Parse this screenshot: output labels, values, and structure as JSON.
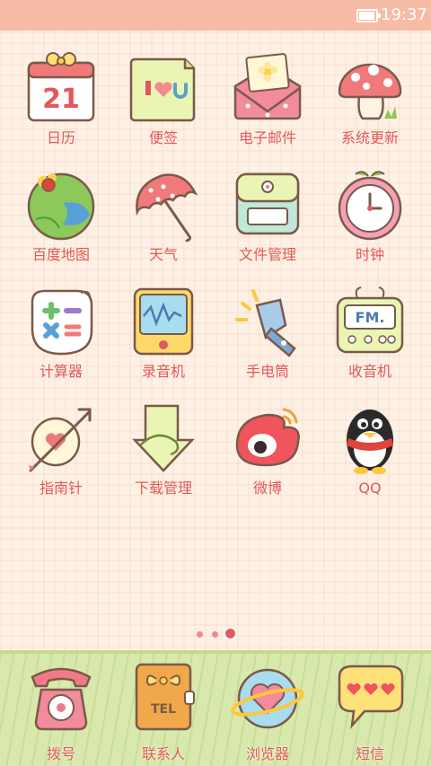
{
  "status_bar": {
    "time": "19:37",
    "battery_level": 0.95
  },
  "apps": [
    {
      "id": "calendar",
      "label": "日历",
      "icon": "calendar-icon",
      "day": "21"
    },
    {
      "id": "notes",
      "label": "便签",
      "icon": "notes-icon"
    },
    {
      "id": "email",
      "label": "电子邮件",
      "icon": "email-icon"
    },
    {
      "id": "update",
      "label": "系统更新",
      "icon": "mushroom-icon"
    },
    {
      "id": "maps",
      "label": "百度地图",
      "icon": "map-icon"
    },
    {
      "id": "weather",
      "label": "天气",
      "icon": "umbrella-icon"
    },
    {
      "id": "files",
      "label": "文件管理",
      "icon": "folder-icon"
    },
    {
      "id": "clock",
      "label": "时钟",
      "icon": "clock-icon"
    },
    {
      "id": "calculator",
      "label": "计算器",
      "icon": "calculator-icon"
    },
    {
      "id": "recorder",
      "label": "录音机",
      "icon": "recorder-icon"
    },
    {
      "id": "flashlight",
      "label": "手电筒",
      "icon": "flashlight-icon"
    },
    {
      "id": "radio",
      "label": "收音机",
      "icon": "radio-icon",
      "screen_text": "FM."
    },
    {
      "id": "compass",
      "label": "指南针",
      "icon": "compass-icon"
    },
    {
      "id": "downloads",
      "label": "下载管理",
      "icon": "download-icon"
    },
    {
      "id": "weibo",
      "label": "微博",
      "icon": "weibo-icon"
    },
    {
      "id": "qq",
      "label": "QQ",
      "icon": "penguin-icon"
    }
  ],
  "page_indicator": {
    "count": 3,
    "active_index": 2
  },
  "dock": [
    {
      "id": "dialer",
      "label": "拨号",
      "icon": "phone-icon"
    },
    {
      "id": "contacts",
      "label": "联系人",
      "icon": "contacts-book-icon",
      "badge": "TEL"
    },
    {
      "id": "browser",
      "label": "浏览器",
      "icon": "globe-heart-icon"
    },
    {
      "id": "sms",
      "label": "短信",
      "icon": "message-hearts-icon"
    }
  ],
  "colors": {
    "label": "#e05a5a",
    "status_bar": "#f7bca6",
    "dock": "#d9e8ac",
    "background": "#fdf0e4"
  }
}
